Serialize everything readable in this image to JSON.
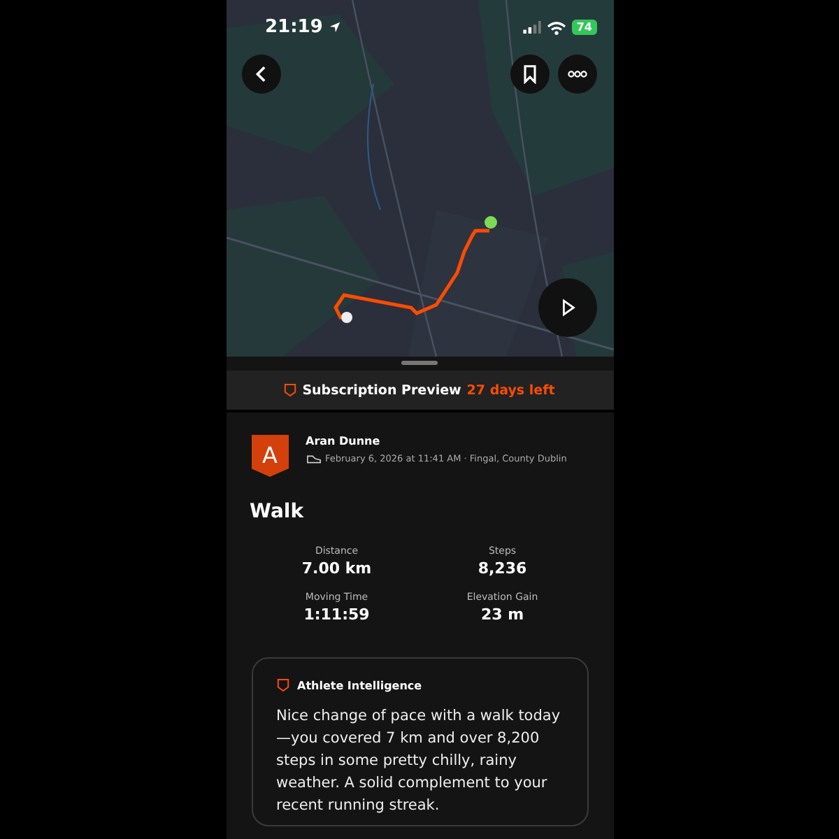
{
  "status_bar": {
    "time": "21:19",
    "battery": "74"
  },
  "subscription": {
    "label": "Subscription Preview",
    "remaining": "27 days left"
  },
  "athlete": {
    "initial": "A",
    "name": "Aran Dunne",
    "meta": "February 6, 2026 at 11:41 AM · Fingal, County Dublin"
  },
  "activity": {
    "title": "Walk"
  },
  "stats": [
    {
      "label": "Distance",
      "value": "7.00 km"
    },
    {
      "label": "Steps",
      "value": "8,236"
    },
    {
      "label": "Moving Time",
      "value": "1:11:59"
    },
    {
      "label": "Elevation Gain",
      "value": "23 m"
    }
  ],
  "insight": {
    "title": "Athlete Intelligence",
    "text": "Nice change of pace with a walk today—you covered 7 km and over 8,200 steps in some pretty chilly, rainy weather. A solid complement to your recent running streak."
  }
}
